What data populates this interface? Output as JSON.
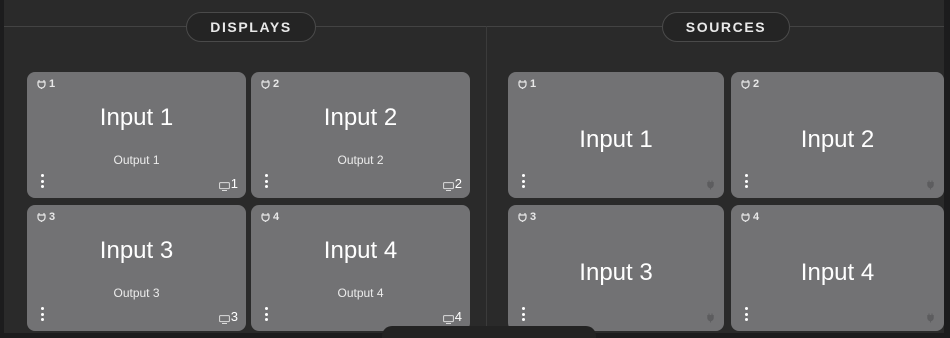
{
  "displays": {
    "header": "DISPLAYS",
    "cards": [
      {
        "number": "1",
        "input": "Input 1",
        "output": "Output 1",
        "output_number": "1"
      },
      {
        "number": "2",
        "input": "Input 2",
        "output": "Output 2",
        "output_number": "2"
      },
      {
        "number": "3",
        "input": "Input 3",
        "output": "Output 3",
        "output_number": "3"
      },
      {
        "number": "4",
        "input": "Input 4",
        "output": "Output 4",
        "output_number": "4"
      }
    ]
  },
  "sources": {
    "header": "SOURCES",
    "cards": [
      {
        "number": "1",
        "input": "Input 1"
      },
      {
        "number": "2",
        "input": "Input 2"
      },
      {
        "number": "3",
        "input": "Input 3"
      },
      {
        "number": "4",
        "input": "Input 4"
      }
    ]
  },
  "colors": {
    "background": "#2a2a2a",
    "card": "#727274",
    "header_border": "#4a4a4a"
  },
  "icons": {
    "card_number_icon": "plug-icon",
    "menu": "kebab-menu-icon",
    "output": "monitor-icon",
    "source_status": "plug-icon"
  }
}
